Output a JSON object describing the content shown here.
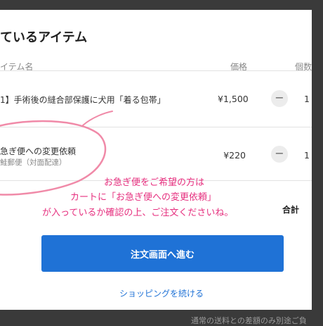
{
  "cart": {
    "title": "ているアイテム",
    "columns": {
      "item": "イテム名",
      "price": "価格",
      "qty": "個数"
    },
    "items": [
      {
        "name": "1】手術後の縫合部保護に犬用「着る包帯」",
        "sub": "",
        "price": "¥1,500",
        "qty": "1"
      },
      {
        "name": "急ぎ便への変更依頼",
        "sub": "鮭郵便（対面配達）",
        "price": "¥220",
        "qty": "1"
      }
    ],
    "total_label": "合計",
    "minus_symbol": "−",
    "checkout_label": "注文画面へ進む",
    "continue_label": "ショッピングを続ける"
  },
  "annotation": {
    "line1": "お急ぎ便をご希望の方は",
    "line2": "カートに「お急ぎ便への変更依頼」",
    "line3": "が入っているか確認の上、ご注文くださいね。",
    "color": "#e6307f"
  },
  "background_note": "通常の送料との差額のみ別途ご負"
}
